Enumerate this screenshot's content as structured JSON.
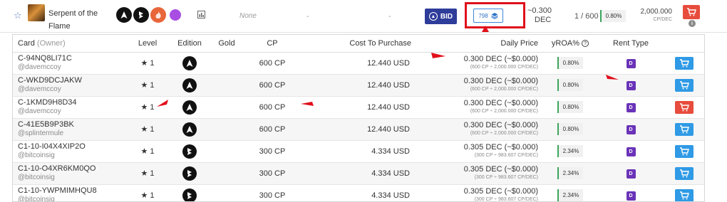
{
  "summary": {
    "card_name": "Serpent of the Flame",
    "element_icons": [
      "triangle-icon",
      "bolt-icon",
      "fire-icon",
      "purple-dot-icon"
    ],
    "gold_text": "None",
    "dash_a": "-",
    "dash_b": "-",
    "bid_label": "BID",
    "stack_count": "798",
    "price_line1": "~0.300",
    "price_line2": "DEC",
    "cp_count": "1 / 600 CP",
    "roa": "0.80%",
    "cp_dec_value": "2,000.000",
    "cp_dec_unit": "CP/DEC",
    "annotation_label": "1"
  },
  "table": {
    "headers": {
      "card": "Card",
      "owner": "(Owner)",
      "level": "Level",
      "edition": "Edition",
      "gold": "Gold",
      "cp": "CP",
      "cost": "Cost To Purchase",
      "daily_price": "Daily Price",
      "yroa": "yROA%",
      "help": "?",
      "rent_type": "Rent Type"
    },
    "rows": [
      {
        "id": "C-94NQ8LI71C",
        "owner": "@davemccoy",
        "level": "1",
        "edition_icon": "triangle-icon",
        "cp": "600 CP",
        "cost": "12.440 USD",
        "price_main": "0.300 DEC (~$0.000)",
        "price_sub": "(600 CP ÷ 2,000.000 CP/DEC)",
        "roa": "0.80%",
        "rent": "D",
        "cart_color": "#2f9ae5"
      },
      {
        "id": "C-WKD9DCJAKW",
        "owner": "@davemccoy",
        "level": "1",
        "edition_icon": "triangle-icon",
        "cp": "600 CP",
        "cost": "12.440 USD",
        "price_main": "0.300 DEC (~$0.000)",
        "price_sub": "(600 CP ÷ 2,000.000 CP/DEC)",
        "roa": "0.80%",
        "rent": "D",
        "cart_color": "#2f9ae5"
      },
      {
        "id": "C-1KMD9H8D34",
        "owner": "@davemccoy",
        "level": "1",
        "edition_icon": "triangle-icon",
        "cp": "600 CP",
        "cost": "12.440 USD",
        "price_main": "0.300 DEC (~$0.000)",
        "price_sub": "(600 CP ÷ 2,000.000 CP/DEC)",
        "roa": "0.80%",
        "rent": "D",
        "cart_color": "#e74c3c"
      },
      {
        "id": "C-41E5B9P3BK",
        "owner": "@splintermule",
        "level": "1",
        "edition_icon": "triangle-icon",
        "cp": "600 CP",
        "cost": "12.440 USD",
        "price_main": "0.300 DEC (~$0.000)",
        "price_sub": "(600 CP ÷ 2,000.000 CP/DEC)",
        "roa": "0.80%",
        "rent": "D",
        "cart_color": "#2f9ae5"
      },
      {
        "id": "C1-10-I04X4XIP2O",
        "owner": "@bitcoinsig",
        "level": "1",
        "edition_icon": "bolt-icon",
        "cp": "300 CP",
        "cost": "4.334 USD",
        "price_main": "0.305 DEC (~$0.000)",
        "price_sub": "(300 CP ÷ 983.607 CP/DEC)",
        "roa": "2.34%",
        "rent": "D",
        "cart_color": "#2f9ae5"
      },
      {
        "id": "C1-10-O4XR6KM0QO",
        "owner": "@bitcoinsig",
        "level": "1",
        "edition_icon": "bolt-icon",
        "cp": "300 CP",
        "cost": "4.334 USD",
        "price_main": "0.305 DEC (~$0.000)",
        "price_sub": "(300 CP ÷ 983.607 CP/DEC)",
        "roa": "2.34%",
        "rent": "D",
        "cart_color": "#2f9ae5"
      },
      {
        "id": "C1-10-YWPMIMHQU8",
        "owner": "@bitcoinsig",
        "level": "1",
        "edition_icon": "bolt-icon",
        "cp": "300 CP",
        "cost": "4.334 USD",
        "price_main": "0.305 DEC (~$0.000)",
        "price_sub": "(300 CP ÷ 983.607 CP/DEC)",
        "roa": "2.34%",
        "rent": "D",
        "cart_color": "#2f9ae5"
      }
    ]
  },
  "colors": {
    "annotation_red": "#e0101b",
    "bid_blue": "#2e3d9a",
    "cart_blue": "#2f9ae5",
    "cart_red": "#e74c3c",
    "rent_purple": "#6a33b8",
    "roa_green": "#3ca55c"
  }
}
